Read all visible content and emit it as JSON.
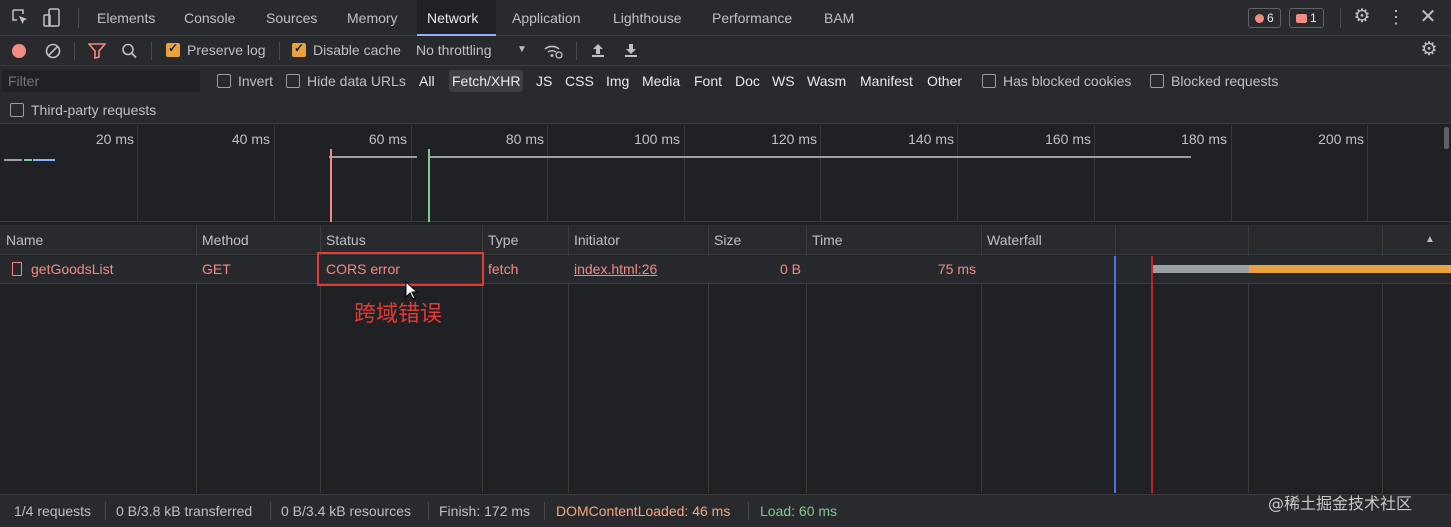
{
  "tabs": {
    "items": [
      "Elements",
      "Console",
      "Sources",
      "Memory",
      "Network",
      "Application",
      "Lighthouse",
      "Performance",
      "BAM"
    ],
    "active": "Network",
    "error_count": "6",
    "issue_count": "1"
  },
  "toolbar": {
    "preserve_log": "Preserve log",
    "disable_cache": "Disable cache",
    "throttling": "No throttling",
    "preserve_log_checked": true,
    "disable_cache_checked": true
  },
  "filterbar": {
    "filter_placeholder": "Filter",
    "invert": "Invert",
    "hide_data_urls": "Hide data URLs",
    "types": [
      "All",
      "Fetch/XHR",
      "JS",
      "CSS",
      "Img",
      "Media",
      "Font",
      "Doc",
      "WS",
      "Wasm",
      "Manifest",
      "Other"
    ],
    "selected_type": "Fetch/XHR",
    "has_blocked_cookies": "Has blocked cookies",
    "blocked_requests": "Blocked requests",
    "third_party": "Third-party requests"
  },
  "overview": {
    "ticks": [
      "20 ms",
      "40 ms",
      "60 ms",
      "80 ms",
      "100 ms",
      "120 ms",
      "140 ms",
      "160 ms",
      "180 ms",
      "200 ms"
    ]
  },
  "table": {
    "columns": [
      "Name",
      "Method",
      "Status",
      "Type",
      "Initiator",
      "Size",
      "Time",
      "Waterfall"
    ],
    "rows": [
      {
        "name": "getGoodsList",
        "method": "GET",
        "status": "CORS error",
        "type": "fetch",
        "initiator": "index.html:26",
        "size": "0 B",
        "time": "75 ms"
      }
    ]
  },
  "annotation": {
    "text": "跨域错误",
    "color": "#e53935"
  },
  "statusbar": {
    "requests": "1/4 requests",
    "transferred": "0 B/3.8 kB transferred",
    "resources": "0 B/3.4 kB resources",
    "finish": "Finish: 172 ms",
    "dom_content_loaded": "DOMContentLoaded: 46 ms",
    "load": "Load: 60 ms"
  },
  "watermark": "@稀土掘金技术社区",
  "colors": {
    "error": "#f28b82",
    "dcl": "#f5a97f",
    "load": "#81c995",
    "waterfall_wait": "#9aa0a6",
    "waterfall_download": "#e8a33d"
  }
}
